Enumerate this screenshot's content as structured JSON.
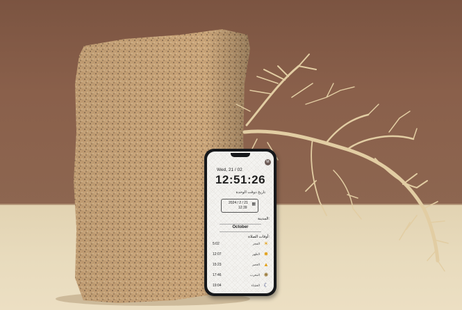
{
  "phone_screen": {
    "date": "Wed, 21 / 02",
    "clock": "12:51:26",
    "hijri_label": "تاريخ دوقت الوحدة",
    "hijri_date": "2024 / 2 / 21",
    "hijri_time": "12:39",
    "avatar_letter": "M",
    "city_label": "المدينة:",
    "month": "October",
    "prayers_title": "أوقات الصلاة:",
    "prayers": [
      {
        "time": "5:02",
        "name": "الفجر",
        "icon": "sunrise-icon"
      },
      {
        "time": "12:07",
        "name": "الظهر",
        "icon": "sun-icon"
      },
      {
        "time": "15:23",
        "name": "العصر",
        "icon": "sun-low-icon"
      },
      {
        "time": "17:46",
        "name": "المغرب",
        "icon": "sunset-icon"
      },
      {
        "time": "19:04",
        "name": "العشاء",
        "icon": "moon-icon"
      }
    ]
  },
  "colors": {
    "wall": "#8a604b",
    "floor": "#e8dbbd",
    "stone": "#c8a276",
    "branch": "#e3cfa5",
    "phone_body": "#16181b"
  }
}
